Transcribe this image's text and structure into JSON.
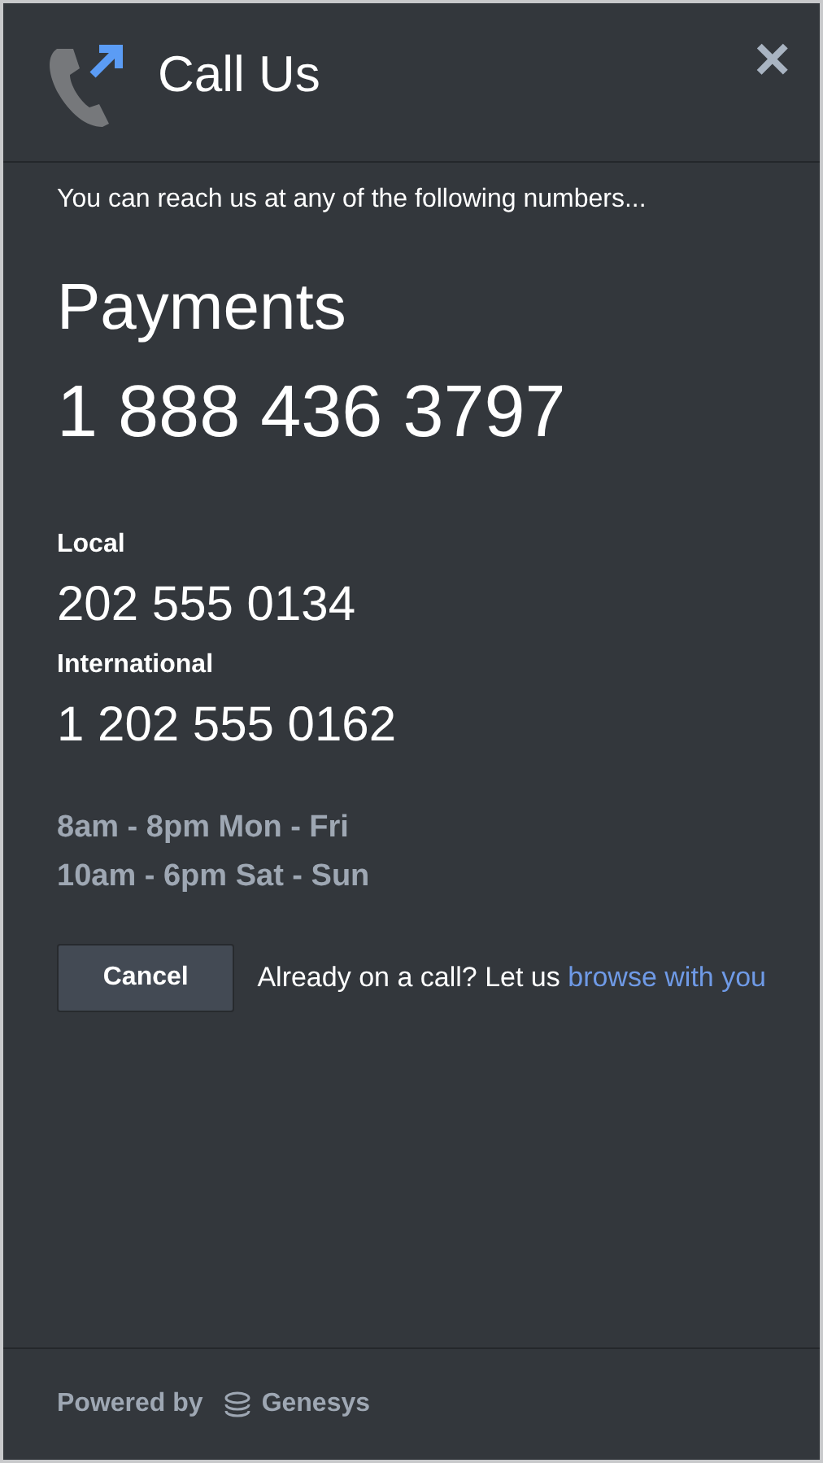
{
  "header": {
    "title": "Call Us",
    "close": "×"
  },
  "intro": "You can reach us at any of the following numbers...",
  "primary": {
    "label": "Payments",
    "number": "1 888 436 3797"
  },
  "numbers": [
    {
      "label": "Local",
      "number": "202 555 0134"
    },
    {
      "label": "International",
      "number": "1 202 555 0162"
    }
  ],
  "hours": [
    "8am - 8pm Mon - Fri",
    "10am - 6pm Sat - Sun"
  ],
  "cancel_button": "Cancel",
  "browse": {
    "text": "Already on a call? Let us",
    "link": "browse with you"
  },
  "footer": {
    "powered_by": "Powered by",
    "brand": "Genesys"
  }
}
